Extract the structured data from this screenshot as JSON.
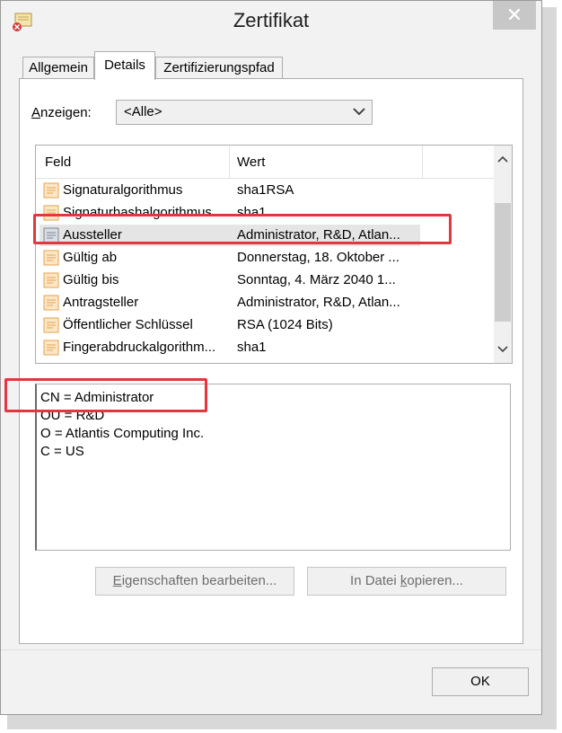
{
  "window": {
    "title": "Zertifikat",
    "close_glyph": "✕"
  },
  "tabs": [
    {
      "label": "Allgemein"
    },
    {
      "label": "Details"
    },
    {
      "label": "Zertifizierungspfad"
    }
  ],
  "show": {
    "label_prefix": "A",
    "label_rest": "nzeigen:",
    "selected": "<Alle>"
  },
  "list": {
    "columns": [
      "Feld",
      "Wert"
    ],
    "rows": [
      {
        "feld": "Signaturalgorithmus",
        "wert": "sha1RSA",
        "icon": "certificate-field-icon"
      },
      {
        "feld": "Signaturhashalgorithmus",
        "wert": "sha1",
        "icon": "certificate-field-icon"
      },
      {
        "feld": "Aussteller",
        "wert": "Administrator, R&D, Atlan...",
        "icon": "certificate-field-icon",
        "selected": true
      },
      {
        "feld": "Gültig ab",
        "wert": "Donnerstag, 18. Oktober ...",
        "icon": "certificate-field-icon"
      },
      {
        "feld": "Gültig bis",
        "wert": "Sonntag, 4. März 2040 1...",
        "icon": "certificate-field-icon"
      },
      {
        "feld": "Antragsteller",
        "wert": "Administrator, R&D, Atlan...",
        "icon": "certificate-field-icon"
      },
      {
        "feld": "Öffentlicher Schlüssel",
        "wert": "RSA (1024 Bits)",
        "icon": "certificate-field-icon"
      },
      {
        "feld": "Fingerabdruckalgorithm...",
        "wert": "sha1",
        "icon": "certificate-field-icon"
      }
    ]
  },
  "detail_lines": [
    "CN = Administrator",
    "OU = R&D",
    "O = Atlantis Computing Inc.",
    "C = US"
  ],
  "buttons": {
    "edit": {
      "u": "E",
      "rest": "igenschaften bearbeiten..."
    },
    "copy": {
      "pre": "In Datei ",
      "u": "k",
      "rest": "opieren..."
    },
    "ok": "OK"
  },
  "colors": {
    "highlight": "#e2383d",
    "icon_orange": "#e8a24a",
    "selection": "#e5e5e5"
  }
}
